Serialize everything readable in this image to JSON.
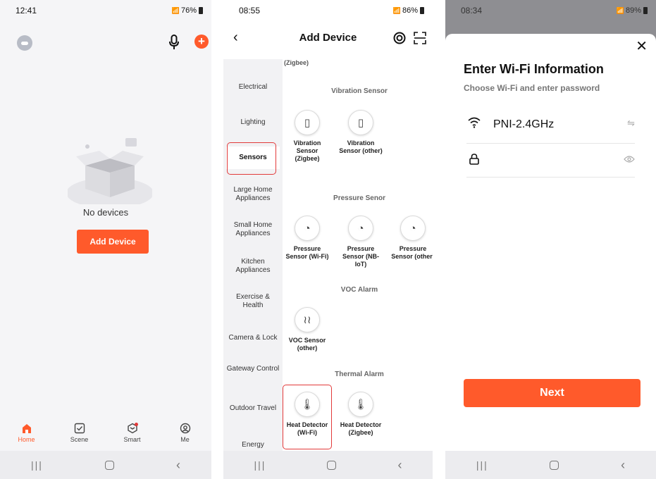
{
  "screen1": {
    "status": {
      "time": "12:41",
      "battery": "76%"
    },
    "empty_text": "No devices",
    "add_button": "Add Device",
    "tabs": [
      {
        "label": "Home",
        "active": true
      },
      {
        "label": "Scene",
        "active": false
      },
      {
        "label": "Smart",
        "active": false
      },
      {
        "label": "Me",
        "active": false
      }
    ]
  },
  "screen2": {
    "status": {
      "time": "08:55",
      "battery": "86%"
    },
    "title": "Add Device",
    "truncated_label": "(Zigbee)",
    "categories": [
      "Electrical",
      "Lighting",
      "Sensors",
      "Large Home Appliances",
      "Small Home Appliances",
      "Kitchen Appliances",
      "Exercise & Health",
      "Camera & Lock",
      "Gateway Control",
      "Outdoor Travel",
      "Energy"
    ],
    "selected_category": "Sensors",
    "sections": [
      {
        "title": "Vibration Sensor",
        "devices": [
          {
            "name": "Vibration Sensor (Zigbee)",
            "icon": "vibration-icon"
          },
          {
            "name": "Vibration Sensor (other)",
            "icon": "vibration-icon"
          }
        ]
      },
      {
        "title": "Pressure Senor",
        "devices": [
          {
            "name": "Pressure Sensor (Wi-Fi)",
            "icon": "gauge-icon"
          },
          {
            "name": "Pressure Sensor (NB-IoT)",
            "icon": "gauge-icon"
          },
          {
            "name": "Pressure Sensor (other)",
            "icon": "gauge-icon"
          }
        ]
      },
      {
        "title": "VOC Alarm",
        "devices": [
          {
            "name": "VOC Sensor (other)",
            "icon": "heat-waves-icon"
          }
        ]
      },
      {
        "title": "Thermal Alarm",
        "devices": [
          {
            "name": "Heat Detector (Wi-Fi)",
            "icon": "thermometer-icon"
          },
          {
            "name": "Heat Detector (Zigbee)",
            "icon": "thermometer-icon"
          }
        ]
      }
    ],
    "highlight_color": "#e23a3a"
  },
  "screen3": {
    "status": {
      "time": "08:34",
      "battery": "89%"
    },
    "title": "Enter Wi-Fi Information",
    "subtitle": "Choose Wi-Fi and enter password",
    "ssid": "PNI-2.4GHz",
    "password_value": "",
    "next_button": "Next"
  },
  "accent_color": "#ff5a2b"
}
